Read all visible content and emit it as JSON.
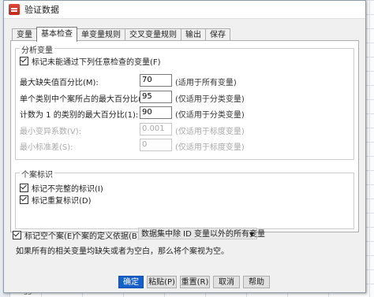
{
  "window": {
    "title": "验证数据"
  },
  "tabs": [
    "变量",
    "基本检查",
    "单变量规则",
    "交叉变量规则",
    "输出",
    "保存"
  ],
  "analysis": {
    "legend": "分析变量",
    "flag_failed": {
      "label": "标记未能通过下列任意检查的变量(F)",
      "checked": true
    },
    "rows": [
      {
        "label": "最大缺失值百分比(M):",
        "value": "70",
        "note": "(适用于所有变量)",
        "enabled": true
      },
      {
        "label": "单个类别中个案所占的最大百分比(C):",
        "value": "95",
        "note": "(仅适用于分类变量)",
        "enabled": true
      },
      {
        "label": "计数为 1 的类别的最大百分比(1):",
        "value": "90",
        "note": "(仅适用于分类变量)",
        "enabled": true
      },
      {
        "label": "最小变异系数(V):",
        "value": "0.001",
        "note": "(仅适用于标度变量)",
        "enabled": false
      },
      {
        "label": "最小标准差(S):",
        "value": "0",
        "note": "(仅适用于标度变量)",
        "enabled": false
      }
    ]
  },
  "case_id": {
    "legend": "个案标识",
    "incomplete": {
      "label": "标记不完整的标识(I)",
      "checked": true
    },
    "duplicate": {
      "label": "标记重复标识(D)",
      "checked": true
    }
  },
  "empty_case": {
    "label": "标记空个案(E)",
    "checked": true,
    "definition_label": "个案的定义依据(B):",
    "definition_value": "数据集中除 ID 变量以外的所有变量",
    "hint": "如果所有的相关变量均缺失或者为空白，那么将个案视为空。"
  },
  "buttons": {
    "ok": "确定",
    "paste": "粘贴(P)",
    "reset": "重置(R)",
    "cancel": "取消",
    "help": "帮助"
  },
  "background": {
    "row_number": "55"
  },
  "colors": {
    "primary": "#1660cc"
  }
}
